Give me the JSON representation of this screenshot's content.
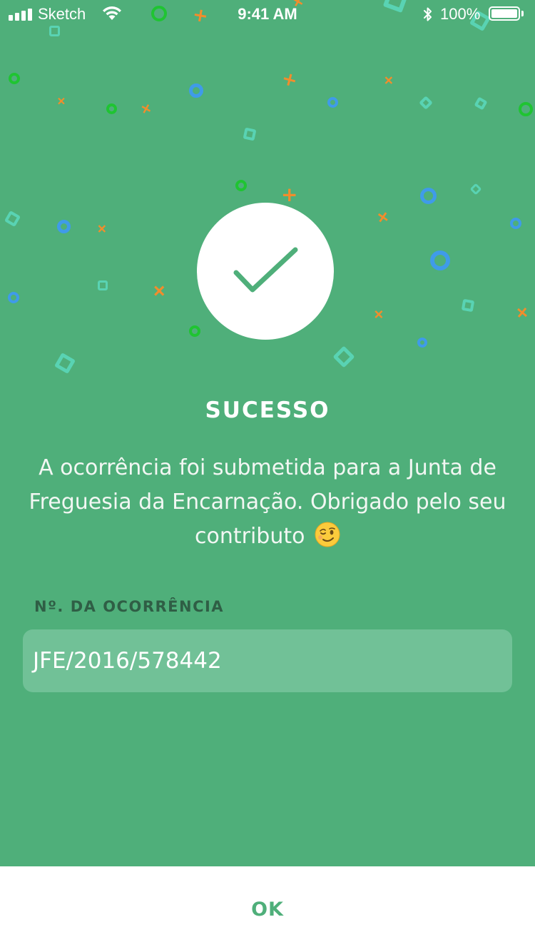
{
  "status_bar": {
    "carrier": "Sketch",
    "time": "9:41 AM",
    "battery_percent": "100%",
    "battery_level": 1.0
  },
  "success": {
    "title": "SUCESSO",
    "message": "A ocorrência foi submetida para a Junta de Freguesia da Encarnação. Obrigado pelo seu contributo",
    "emoji": "wink-emoji-icon"
  },
  "occurrence": {
    "label": "Nº. DA OCORRÊNCIA",
    "value": "JFE/2016/578442"
  },
  "footer": {
    "ok_label": "OK"
  },
  "colors": {
    "background": "#4faf7a",
    "field_background": "#71c197",
    "accent": "#4faf7a",
    "confetti_green": "#1fc432",
    "confetti_blue": "#3f9be9",
    "confetti_teal": "#59d3b3",
    "confetti_orange": "#f28d2c"
  }
}
